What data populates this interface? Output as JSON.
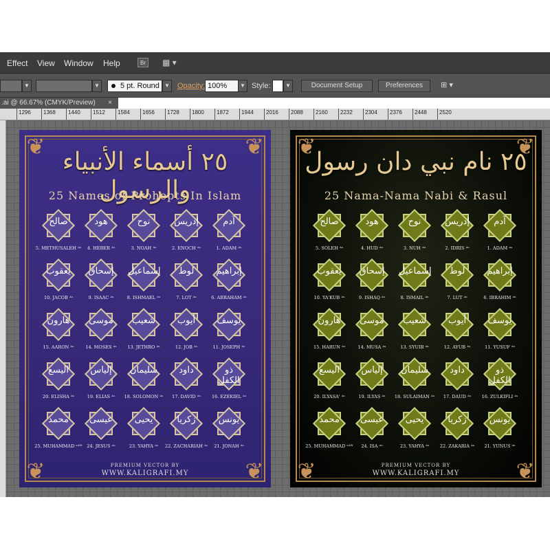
{
  "menus": {
    "effect": "Effect",
    "view": "View",
    "window": "Window",
    "help": "Help",
    "bridge": "Br"
  },
  "control": {
    "stroke_profile": "5 pt. Round",
    "opacity_label": "Opacity:",
    "opacity_value": "100%",
    "style_label": "Style:",
    "document_setup": "Document Setup",
    "preferences": "Preferences"
  },
  "tab": {
    "title": ".ai @ 66.67% (CMYK/Preview)",
    "close": "×"
  },
  "ruler": [
    "1296",
    "1368",
    "1440",
    "1512",
    "1584",
    "1656",
    "1728",
    "1800",
    "1872",
    "1944",
    "2016",
    "2088",
    "2160",
    "2232",
    "2304",
    "2376",
    "2448",
    "2520"
  ],
  "left_poster": {
    "arabic_title": "٢٥ أسماء الأنبياء والرسول",
    "english_title": "25 Names of Prohepts In Islam",
    "rows": [
      [
        {
          "ar": "صالح",
          "label": "5. METHUSALEH ᴬˢ"
        },
        {
          "ar": "هود",
          "label": "4. HEBER ᴬˢ"
        },
        {
          "ar": "نوح",
          "label": "3. NOAH ᴬˢ"
        },
        {
          "ar": "إدريس",
          "label": "2. ENOCH ᴬˢ"
        },
        {
          "ar": "آدم",
          "label": "1. ADAM ᴬˢ"
        }
      ],
      [
        {
          "ar": "يعقوب",
          "label": "10. JACOB ᴬˢ"
        },
        {
          "ar": "إسحاق",
          "label": "9. ISAAC ᴬˢ"
        },
        {
          "ar": "إسماعيل",
          "label": "8. ISHMAEL ᴬˢ"
        },
        {
          "ar": "لوط",
          "label": "7. LOT ᴬˢ"
        },
        {
          "ar": "إبراهيم",
          "label": "6. ABRAHAM ᴬˢ"
        }
      ],
      [
        {
          "ar": "هارون",
          "label": "15. AARON ᴬˢ"
        },
        {
          "ar": "موسى",
          "label": "14. MOSES ᴬˢ"
        },
        {
          "ar": "شعيب",
          "label": "13. JETHRO ᴬˢ"
        },
        {
          "ar": "أيوب",
          "label": "12. JOB ᴬˢ"
        },
        {
          "ar": "يوسف",
          "label": "11. JOSEPH ᴬˢ"
        }
      ],
      [
        {
          "ar": "اليسع",
          "label": "20. ELISHA ᴬˢ"
        },
        {
          "ar": "إلياس",
          "label": "19. ELIAS ᴬˢ"
        },
        {
          "ar": "سليمان",
          "label": "18. SOLOMON ᴬˢ"
        },
        {
          "ar": "داود",
          "label": "17. DAVID ᴬˢ"
        },
        {
          "ar": "ذو الكفل",
          "label": "16. EZEKIEL ᴬˢ"
        }
      ],
      [
        {
          "ar": "محمد",
          "label": "25. MUHAMMAD ˢᴬᵂ"
        },
        {
          "ar": "عيسى",
          "label": "24. JESUS ᴬˢ"
        },
        {
          "ar": "يحيى",
          "label": "23. YAHYA ᴬˢ"
        },
        {
          "ar": "زكريا",
          "label": "22. ZACHARIAH ᴬˢ"
        },
        {
          "ar": "يونس",
          "label": "21. JONAH ᴬˢ"
        }
      ]
    ],
    "footer_small": "PREMIUM VECTOR BY",
    "footer_url": "WWW.KALIGRAFI.MY"
  },
  "right_poster": {
    "arabic_title": "٢٥ نام نبي دان رسول",
    "english_title": "25 Nama-Nama Nabi & Rasul",
    "rows": [
      [
        {
          "ar": "صالح",
          "label": "5. SOLEH ᴬˢ"
        },
        {
          "ar": "هود",
          "label": "4. HUD ᴬˢ"
        },
        {
          "ar": "نوح",
          "label": "3. NUH ᴬˢ"
        },
        {
          "ar": "إدريس",
          "label": "2. IDRIS ᴬˢ"
        },
        {
          "ar": "آدم",
          "label": "1. ADAM ᴬˢ"
        }
      ],
      [
        {
          "ar": "يعقوب",
          "label": "10. YA'KUB ᴬˢ"
        },
        {
          "ar": "إسحاق",
          "label": "9. ISHAQ ᴬˢ"
        },
        {
          "ar": "إسماعيل",
          "label": "8. ISMAIL ᴬˢ"
        },
        {
          "ar": "لوط",
          "label": "7. LUT ᴬˢ"
        },
        {
          "ar": "إبراهيم",
          "label": "6. IBRAHIM ᴬˢ"
        }
      ],
      [
        {
          "ar": "هارون",
          "label": "15. HARUN ᴬˢ"
        },
        {
          "ar": "موسى",
          "label": "14. MUSA ᴬˢ"
        },
        {
          "ar": "شعيب",
          "label": "13. SYUIB ᴬˢ"
        },
        {
          "ar": "أيوب",
          "label": "12. AYUB ᴬˢ"
        },
        {
          "ar": "يوسف",
          "label": "11. YUSUF ᴬˢ"
        }
      ],
      [
        {
          "ar": "اليسع",
          "label": "20. ILYASA' ᴬˢ"
        },
        {
          "ar": "إلياس",
          "label": "19. ILYAS ᴬˢ"
        },
        {
          "ar": "سليمان",
          "label": "18. SULAIMAN ᴬˢ"
        },
        {
          "ar": "داود",
          "label": "17. DAUD ᴬˢ"
        },
        {
          "ar": "ذو الكفل",
          "label": "16. ZULKIFLI ᴬˢ"
        }
      ],
      [
        {
          "ar": "محمد",
          "label": "25. MUHAMMAD ˢᴬᵂ"
        },
        {
          "ar": "عيسى",
          "label": "24. ISA ᴬˢ"
        },
        {
          "ar": "يحيى",
          "label": "23. YAHYA ᴬˢ"
        },
        {
          "ar": "زكريا",
          "label": "22. ZAKARIA ᴬˢ"
        },
        {
          "ar": "يونس",
          "label": "21. YUNUS ᴬˢ"
        }
      ]
    ],
    "footer_small": "PREMIUM VECTOR BY",
    "footer_url": "WWW.KALIGRAFI.MY"
  },
  "icons": {
    "corner": "❦",
    "dropdown": "▼",
    "arrange": "▦ ▾",
    "selection_tool": "⊞ ▾"
  },
  "colors": {
    "left_bg": "#3a2a7a",
    "right_bg": "#0b0e08",
    "gold": "#e6c892"
  }
}
